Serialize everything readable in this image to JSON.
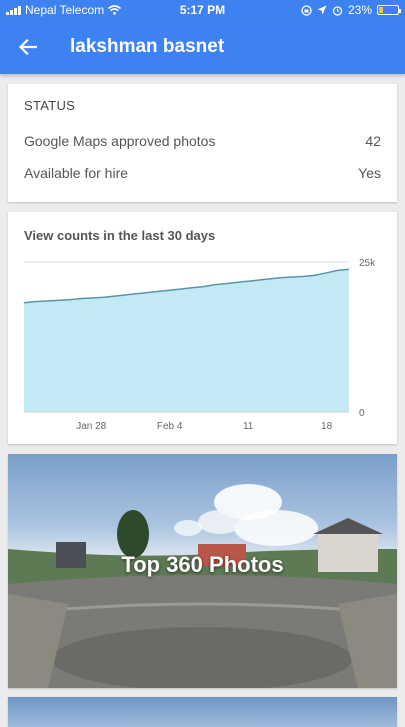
{
  "status_bar": {
    "carrier": "Nepal Telecom",
    "time": "5:17 PM",
    "battery": "23%",
    "battery_level": 0.23
  },
  "app_bar": {
    "title": "lakshman basnet"
  },
  "status": {
    "heading": "STATUS",
    "rows": [
      {
        "label": "Google Maps approved photos",
        "value": "42"
      },
      {
        "label": "Available for hire",
        "value": "Yes"
      }
    ]
  },
  "view_chart": {
    "title": "View counts in the last 30 days"
  },
  "chart_data": {
    "type": "area",
    "title": "View counts in the last 30 days",
    "x_tick_labels": [
      "Jan 28",
      "Feb 4",
      "11",
      "18"
    ],
    "y_tick_labels": [
      "25k",
      "0"
    ],
    "ylim": [
      0,
      25000
    ],
    "values": [
      18200,
      18400,
      18500,
      18600,
      18700,
      18900,
      19000,
      19100,
      19300,
      19500,
      19700,
      19900,
      20100,
      20300,
      20500,
      20700,
      20900,
      21200,
      21400,
      21600,
      21800,
      22000,
      22200,
      22400,
      22500,
      22600,
      22800,
      23200,
      23600,
      23800
    ],
    "color": "#c3eaf4",
    "line_color": "#5c93a8"
  },
  "photos": {
    "label": "Top 360 Photos"
  },
  "colors": {
    "brand": "#3d82f0"
  }
}
